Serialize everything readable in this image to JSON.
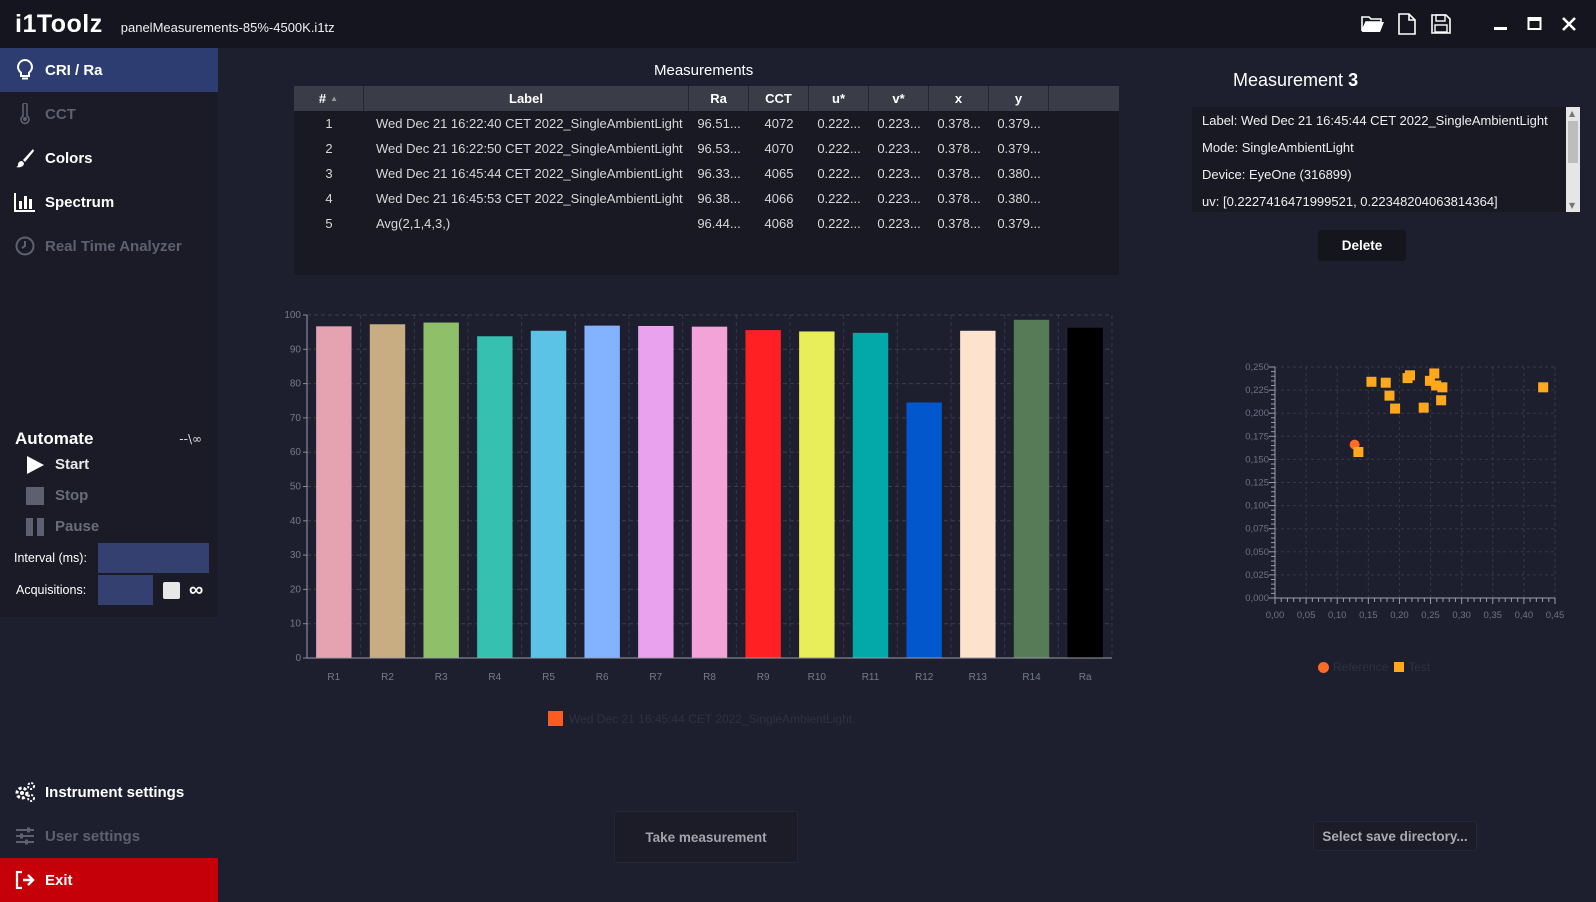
{
  "titlebar": {
    "app_title": "i1Toolz",
    "file_name": "panelMeasurements-85%-4500K.i1tz",
    "icons": [
      "folder-open-icon",
      "new-file-icon",
      "save-icon",
      "minimize-icon",
      "maximize-icon",
      "close-icon"
    ]
  },
  "nav": {
    "items": [
      {
        "label": "CRI / Ra",
        "icon": "lightbulb-icon",
        "state": "active"
      },
      {
        "label": "CCT",
        "icon": "thermometer-icon",
        "state": "disabled"
      },
      {
        "label": "Colors",
        "icon": "brush-icon",
        "state": "normal"
      },
      {
        "label": "Spectrum",
        "icon": "bar-chart-icon",
        "state": "normal"
      },
      {
        "label": "Real Time Analyzer",
        "icon": "clock-icon",
        "state": "disabled"
      }
    ],
    "bottom": [
      {
        "label": "Instrument settings",
        "icon": "gears-icon",
        "state": "normal"
      },
      {
        "label": "User settings",
        "icon": "sliders-icon",
        "state": "disabled"
      },
      {
        "label": "Exit",
        "icon": "exit-icon",
        "state": "exit"
      }
    ]
  },
  "automate": {
    "title": "Automate",
    "counter": "--\\∞",
    "start": "Start",
    "stop": "Stop",
    "pause": "Pause",
    "interval_label": "Interval (ms):",
    "interval_value": "",
    "acquisitions_label": "Acquisitions:",
    "acquisitions_value": "",
    "infinity": "∞"
  },
  "measurements": {
    "title": "Measurements",
    "columns": [
      "#",
      "Label",
      "Ra",
      "CCT",
      "u*",
      "v*",
      "x",
      "y"
    ],
    "rows": [
      [
        "1",
        "Wed Dec 21 16:22:40 CET 2022_SingleAmbientLight",
        "96.51...",
        "4072",
        "0.222...",
        "0.223...",
        "0.378...",
        "0.379..."
      ],
      [
        "2",
        "Wed Dec 21 16:22:50 CET 2022_SingleAmbientLight",
        "96.53...",
        "4070",
        "0.222...",
        "0.223...",
        "0.378...",
        "0.379..."
      ],
      [
        "3",
        "Wed Dec 21 16:45:44 CET 2022_SingleAmbientLight",
        "96.33...",
        "4065",
        "0.222...",
        "0.223...",
        "0.378...",
        "0.380..."
      ],
      [
        "4",
        "Wed Dec 21 16:45:53 CET 2022_SingleAmbientLight",
        "96.38...",
        "4066",
        "0.222...",
        "0.223...",
        "0.378...",
        "0.380..."
      ],
      [
        "5",
        "Avg(2,1,4,3,)",
        "96.44...",
        "4068",
        "0.222...",
        "0.223...",
        "0.378...",
        "0.379..."
      ]
    ]
  },
  "detail": {
    "title": "Measurement",
    "number": "3",
    "lines": [
      "Label: Wed Dec 21 16:45:44 CET 2022_SingleAmbientLight",
      "Mode: SingleAmbientLight",
      "Device: EyeOne (316899)",
      "uv: [0.2227416471999521, 0.22348204063814364]"
    ],
    "delete_label": "Delete"
  },
  "buttons": {
    "take_measurement": "Take measurement",
    "select_dir": "Select save directory..."
  },
  "chart_data": [
    {
      "type": "bar",
      "categories": [
        "R1",
        "R2",
        "R3",
        "R4",
        "R5",
        "R6",
        "R7",
        "R8",
        "R9",
        "R10",
        "R11",
        "R12",
        "R13",
        "R14",
        "Ra"
      ],
      "values": [
        96.7,
        97.3,
        97.8,
        93.8,
        95.4,
        96.9,
        96.8,
        96.6,
        95.6,
        95.2,
        94.8,
        74.5,
        95.4,
        98.6,
        96.3
      ],
      "colors": [
        "#e5a2b0",
        "#c9ad82",
        "#8fbf68",
        "#35c0b0",
        "#5bc3e6",
        "#83b2ff",
        "#e9a3ee",
        "#f4a3d8",
        "#ff2024",
        "#e8ed5a",
        "#03a9a9",
        "#0257cc",
        "#fde2ce",
        "#567b56",
        "#000000"
      ],
      "ylim": [
        0,
        100
      ],
      "yticks": [
        0,
        10,
        20,
        30,
        40,
        50,
        60,
        70,
        80,
        90,
        100
      ],
      "grid": true,
      "legend": {
        "position": "bottom",
        "entries": [
          {
            "name": "Wed Dec 21 16:45:44 CET 2022_SingleAmbientLight",
            "color": "#ff5a1f"
          }
        ]
      }
    },
    {
      "type": "scatter",
      "xlim": [
        0,
        0.45
      ],
      "ylim": [
        0,
        0.25
      ],
      "xticks": [
        "0,00",
        "0,05",
        "0,10",
        "0,15",
        "0,20",
        "0,25",
        "0,30",
        "0,35",
        "0,40",
        "0,45"
      ],
      "yticks": [
        "0,000",
        "0,025",
        "0,050",
        "0,075",
        "0,100",
        "0,125",
        "0,150",
        "0,175",
        "0,200",
        "0,225",
        "0,250"
      ],
      "grid": true,
      "series": [
        {
          "name": "Reference",
          "color": "#ff6a24",
          "marker": "circle",
          "points": [
            [
              0.128,
              0.166
            ]
          ]
        },
        {
          "name": "Test",
          "color": "#ffa81c",
          "marker": "square",
          "points": [
            [
              0.134,
              0.158
            ],
            [
              0.155,
              0.234
            ],
            [
              0.178,
              0.233
            ],
            [
              0.184,
              0.219
            ],
            [
              0.193,
              0.205
            ],
            [
              0.213,
              0.238
            ],
            [
              0.217,
              0.241
            ],
            [
              0.239,
              0.206
            ],
            [
              0.249,
              0.235
            ],
            [
              0.256,
              0.243
            ],
            [
              0.259,
              0.23
            ],
            [
              0.267,
              0.214
            ],
            [
              0.269,
              0.228
            ],
            [
              0.431,
              0.228
            ]
          ]
        }
      ]
    }
  ]
}
